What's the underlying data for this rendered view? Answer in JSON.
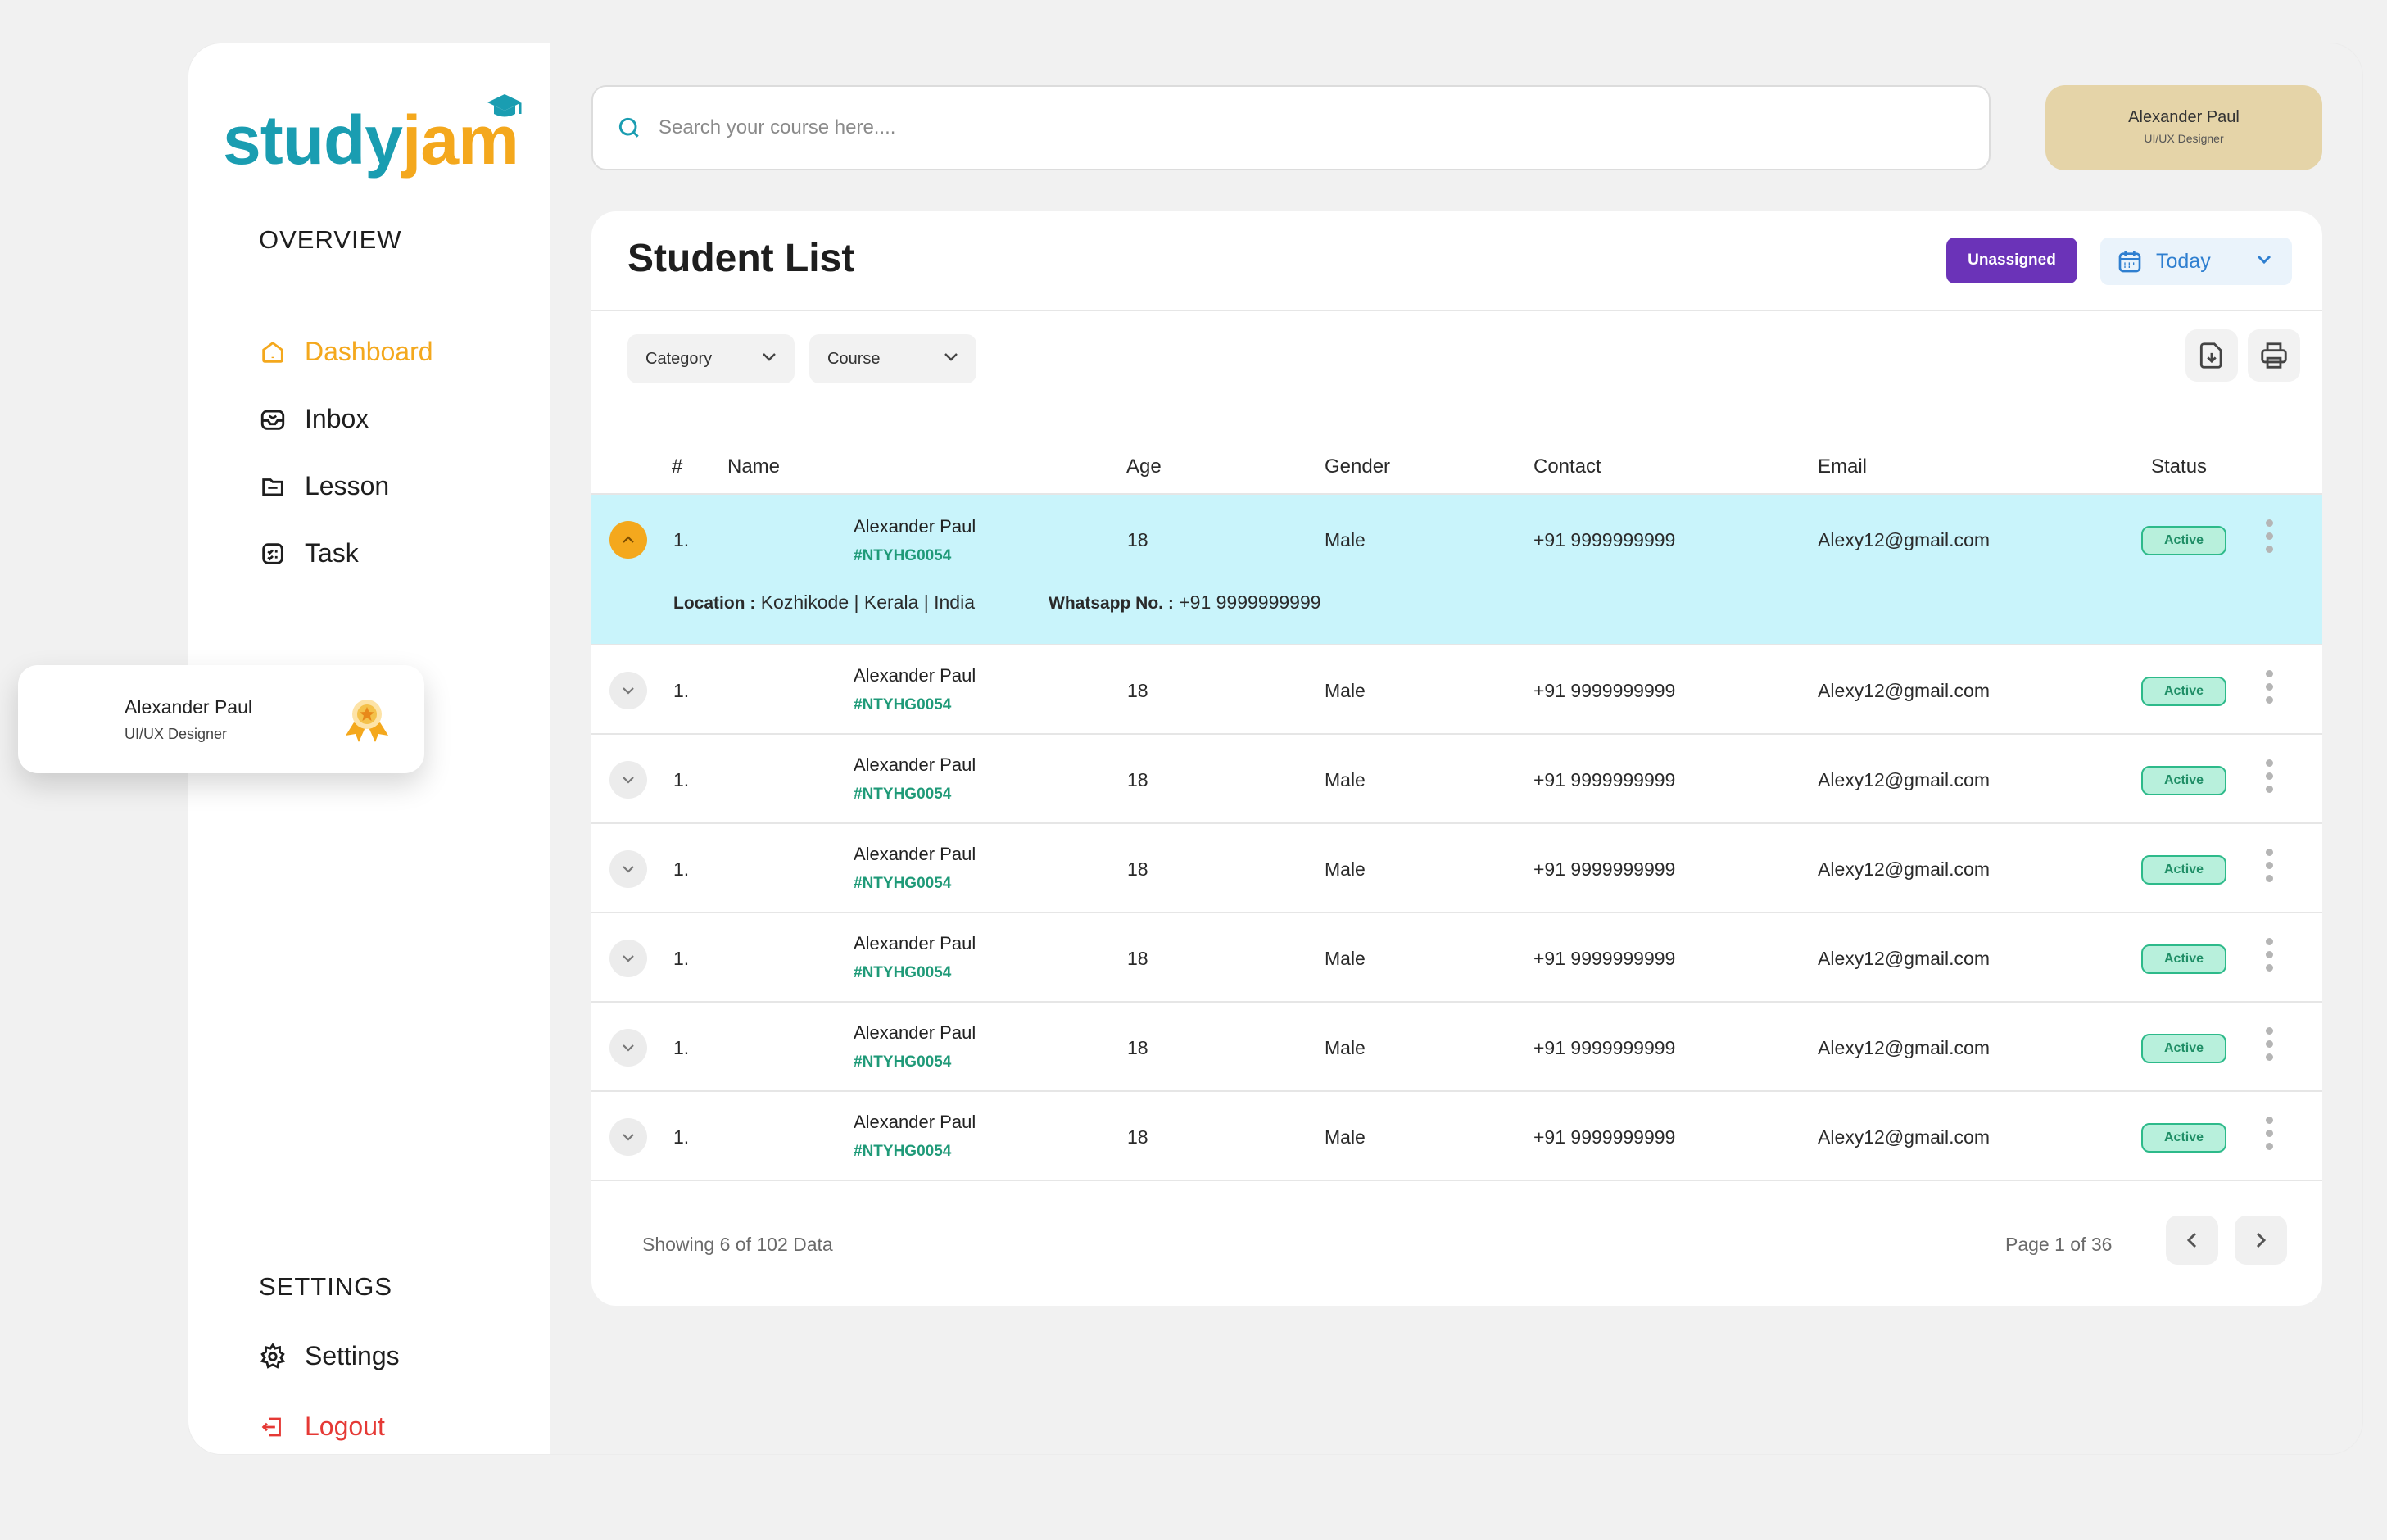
{
  "brand": {
    "study": "study",
    "jam": "jam"
  },
  "sidebar": {
    "overview_title": "OVERVIEW",
    "items": [
      {
        "label": "Dashboard",
        "icon": "home-icon"
      },
      {
        "label": "Inbox",
        "icon": "inbox-icon"
      },
      {
        "label": "Lesson",
        "icon": "folder-icon"
      },
      {
        "label": "Task",
        "icon": "task-icon"
      }
    ],
    "settings_title": "SETTINGS",
    "settings_label": "Settings",
    "logout_label": "Logout"
  },
  "user_card": {
    "name": "Alexander Paul",
    "role": "UI/UX Designer"
  },
  "search": {
    "placeholder": "Search your course here...."
  },
  "profile": {
    "name": "Alexander Paul",
    "role": "UI/UX Designer"
  },
  "panel": {
    "title": "Student List",
    "unassigned_label": "Unassigned",
    "date_label": "Today",
    "filters": {
      "category": "Category",
      "course": "Course"
    }
  },
  "table": {
    "headers": {
      "num": "#",
      "name": "Name",
      "age": "Age",
      "gender": "Gender",
      "contact": "Contact",
      "email": "Email",
      "status": "Status"
    },
    "rows": [
      {
        "num": "1.",
        "name": "Alexander Paul",
        "id": "#NTYHG0054",
        "age": "18",
        "gender": "Male",
        "contact": "+91 9999999999",
        "email": "Alexy12@gmail.com",
        "status": "Active",
        "location_label": "Location :",
        "location": "Kozhikode | Kerala | India",
        "whatsapp_label": "Whatsapp No. :",
        "whatsapp": "+91 9999999999"
      },
      {
        "num": "1.",
        "name": "Alexander Paul",
        "id": "#NTYHG0054",
        "age": "18",
        "gender": "Male",
        "contact": "+91 9999999999",
        "email": "Alexy12@gmail.com",
        "status": "Active"
      },
      {
        "num": "1.",
        "name": "Alexander Paul",
        "id": "#NTYHG0054",
        "age": "18",
        "gender": "Male",
        "contact": "+91 9999999999",
        "email": "Alexy12@gmail.com",
        "status": "Active"
      },
      {
        "num": "1.",
        "name": "Alexander Paul",
        "id": "#NTYHG0054",
        "age": "18",
        "gender": "Male",
        "contact": "+91 9999999999",
        "email": "Alexy12@gmail.com",
        "status": "Active"
      },
      {
        "num": "1.",
        "name": "Alexander Paul",
        "id": "#NTYHG0054",
        "age": "18",
        "gender": "Male",
        "contact": "+91 9999999999",
        "email": "Alexy12@gmail.com",
        "status": "Active"
      },
      {
        "num": "1.",
        "name": "Alexander Paul",
        "id": "#NTYHG0054",
        "age": "18",
        "gender": "Male",
        "contact": "+91 9999999999",
        "email": "Alexy12@gmail.com",
        "status": "Active"
      },
      {
        "num": "1.",
        "name": "Alexander Paul",
        "id": "#NTYHG0054",
        "age": "18",
        "gender": "Male",
        "contact": "+91 9999999999",
        "email": "Alexy12@gmail.com",
        "status": "Active"
      }
    ]
  },
  "footer": {
    "showing": "Showing 6 of  102 Data",
    "page": "Page 1 of 36"
  },
  "colors": {
    "brand_teal": "#1a9db1",
    "brand_orange": "#f4a81d",
    "purple": "#6b33b8",
    "row_highlight": "#c9f4fb",
    "active_green": "#2dba8a"
  }
}
